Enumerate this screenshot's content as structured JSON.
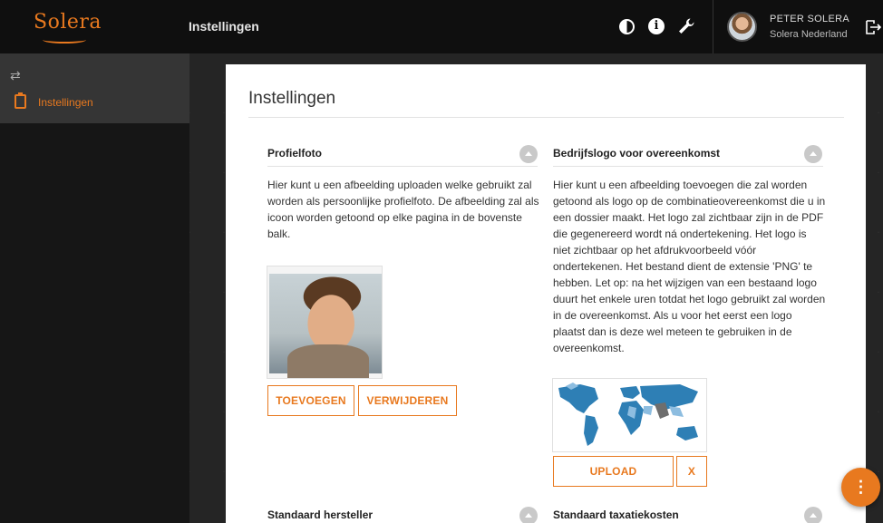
{
  "header": {
    "logo_text": "Solera",
    "title": "Instellingen",
    "icons": [
      "contrast-icon",
      "info-icon",
      "wrench-icon",
      "logout-icon"
    ],
    "user_name": "PETER SOLERA",
    "user_org": "Solera Nederland"
  },
  "sidebar": {
    "items": [
      {
        "label": "Instellingen",
        "icon": "clipboard-icon"
      }
    ]
  },
  "main": {
    "title": "Instellingen",
    "sections": {
      "profielfoto": {
        "title": "Profielfoto",
        "description": "Hier kunt u een afbeelding uploaden welke gebruikt zal worden als persoonlijke profielfoto. De afbeelding zal als icoon worden getoond op elke pagina in de bovenste balk.",
        "add_label": "TOEVOEGEN",
        "remove_label": "VERWIJDEREN"
      },
      "bedrijfslogo": {
        "title": "Bedrijfslogo voor overeenkomst",
        "description": "Hier kunt u een afbeelding toevoegen die zal worden getoond als logo op de combinatieovereenkomst die u in een dossier maakt. Het logo zal zichtbaar zijn in de PDF die gegenereerd wordt ná ondertekening. Het logo is niet zichtbaar op het afdrukvoorbeeld vóór ondertekenen. Het bestand dient de extensie 'PNG' te hebben. Let op: na het wijzigen van een bestaand logo duurt het enkele uren totdat het logo gebruikt zal worden in de overeenkomst. Als u voor het eerst een logo plaatst dan is deze wel meteen te gebruiken in de overeenkomst.",
        "upload_label": "UPLOAD",
        "clear_label": "X"
      },
      "hersteller": {
        "title": "Standaard hersteller"
      },
      "taxatiekosten": {
        "title": "Standaard taxatiekosten"
      }
    }
  },
  "fab_label": "⋮",
  "colors": {
    "accent": "#e8791f",
    "topbar": "#0f0f0f",
    "sidebar": "#161616"
  }
}
